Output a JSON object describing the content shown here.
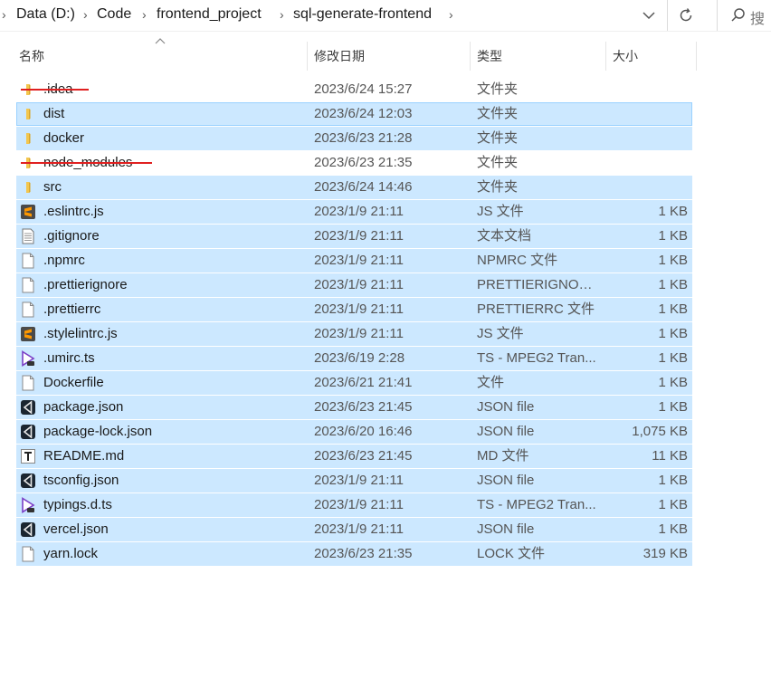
{
  "breadcrumb": [
    "Data (D:)",
    "Code",
    "frontend_project",
    "sql-generate-frontend"
  ],
  "search": {
    "placeholder": "搜"
  },
  "columns": {
    "name": "名称",
    "date": "修改日期",
    "type": "类型",
    "size": "大小"
  },
  "colors": {
    "selection": "#cce8ff",
    "strike": "#e02020",
    "folder": "#f3c64d"
  },
  "files": [
    {
      "name": ".idea",
      "date": "2023/6/24 15:27",
      "type": "文件夹",
      "size": "",
      "icon": "folder-icon",
      "selected": false,
      "struck": true
    },
    {
      "name": "dist",
      "date": "2023/6/24 12:03",
      "type": "文件夹",
      "size": "",
      "icon": "folder-icon",
      "selected": true,
      "focus": true
    },
    {
      "name": "docker",
      "date": "2023/6/23 21:28",
      "type": "文件夹",
      "size": "",
      "icon": "folder-icon",
      "selected": true
    },
    {
      "name": "node_modules",
      "date": "2023/6/23 21:35",
      "type": "文件夹",
      "size": "",
      "icon": "folder-icon",
      "selected": false,
      "struck": true
    },
    {
      "name": "src",
      "date": "2023/6/24 14:46",
      "type": "文件夹",
      "size": "",
      "icon": "folder-icon",
      "selected": true
    },
    {
      "name": ".eslintrc.js",
      "date": "2023/1/9 21:11",
      "type": "JS 文件",
      "size": "1 KB",
      "icon": "sublime-icon",
      "selected": true
    },
    {
      "name": ".gitignore",
      "date": "2023/1/9 21:11",
      "type": "文本文档",
      "size": "1 KB",
      "icon": "text-file-icon",
      "selected": true
    },
    {
      "name": ".npmrc",
      "date": "2023/1/9 21:11",
      "type": "NPMRC 文件",
      "size": "1 KB",
      "icon": "blank-file-icon",
      "selected": true
    },
    {
      "name": ".prettierignore",
      "date": "2023/1/9 21:11",
      "type": "PRETTIERIGNOR...",
      "size": "1 KB",
      "icon": "blank-file-icon",
      "selected": true
    },
    {
      "name": ".prettierrc",
      "date": "2023/1/9 21:11",
      "type": "PRETTIERRC 文件",
      "size": "1 KB",
      "icon": "blank-file-icon",
      "selected": true
    },
    {
      "name": ".stylelintrc.js",
      "date": "2023/1/9 21:11",
      "type": "JS 文件",
      "size": "1 KB",
      "icon": "sublime-icon",
      "selected": true
    },
    {
      "name": ".umirc.ts",
      "date": "2023/6/19 2:28",
      "type": "TS - MPEG2 Tran...",
      "size": "1 KB",
      "icon": "media-icon",
      "selected": true
    },
    {
      "name": "Dockerfile",
      "date": "2023/6/21 21:41",
      "type": "文件",
      "size": "1 KB",
      "icon": "blank-file-icon",
      "selected": true
    },
    {
      "name": "package.json",
      "date": "2023/6/23 21:45",
      "type": "JSON file",
      "size": "1 KB",
      "icon": "vscode-icon",
      "selected": true
    },
    {
      "name": "package-lock.json",
      "date": "2023/6/20 16:46",
      "type": "JSON file",
      "size": "1,075 KB",
      "icon": "vscode-icon",
      "selected": true
    },
    {
      "name": "README.md",
      "date": "2023/6/23 21:45",
      "type": "MD 文件",
      "size": "11 KB",
      "icon": "typora-icon",
      "selected": true
    },
    {
      "name": "tsconfig.json",
      "date": "2023/1/9 21:11",
      "type": "JSON file",
      "size": "1 KB",
      "icon": "vscode-icon",
      "selected": true
    },
    {
      "name": "typings.d.ts",
      "date": "2023/1/9 21:11",
      "type": "TS - MPEG2 Tran...",
      "size": "1 KB",
      "icon": "media-icon",
      "selected": true
    },
    {
      "name": "vercel.json",
      "date": "2023/1/9 21:11",
      "type": "JSON file",
      "size": "1 KB",
      "icon": "vscode-icon",
      "selected": true
    },
    {
      "name": "yarn.lock",
      "date": "2023/6/23 21:35",
      "type": "LOCK 文件",
      "size": "319 KB",
      "icon": "blank-file-icon",
      "selected": true
    }
  ]
}
